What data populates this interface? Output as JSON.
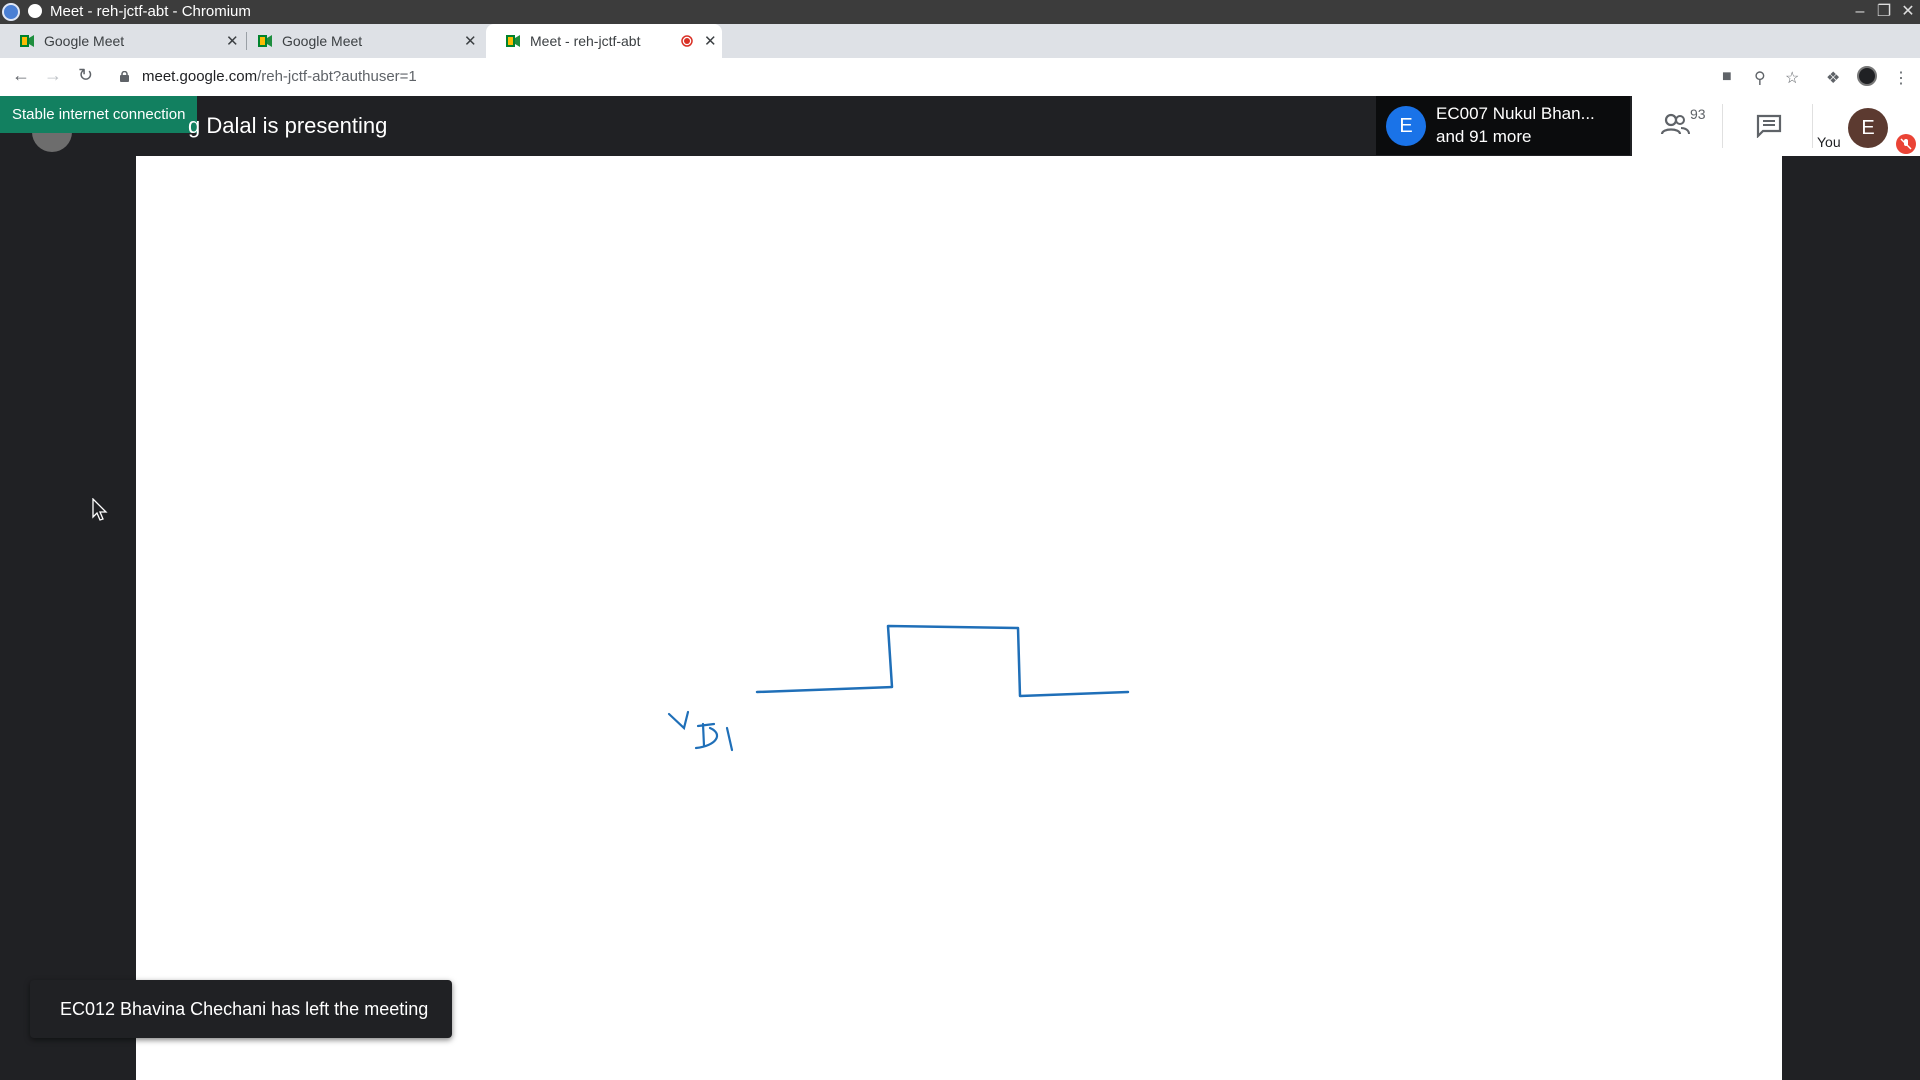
{
  "window": {
    "title": "Meet - reh-jctf-abt - Chromium"
  },
  "tabs": [
    {
      "label": "Google Meet"
    },
    {
      "label": "Google Meet"
    },
    {
      "label": "Meet - reh-jctf-abt"
    }
  ],
  "omnibox": {
    "host": "meet.google.com",
    "path": "/reh-jctf-abt?authuser=1"
  },
  "meet": {
    "connection_status": "Stable internet connection",
    "presenter_text": "g Dalal is presenting",
    "participants_preview": {
      "avatar_letter": "E",
      "line1": "EC007 Nukul Bhan...",
      "line2": "and 91 more"
    },
    "participant_count": "93",
    "self": {
      "label": "You",
      "avatar_letter": "E"
    },
    "toast": "EC012 Bhavina Chechani has left the meeting"
  },
  "colors": {
    "meet_dark": "#202124",
    "stable_green": "#128060",
    "ink_blue": "#1f6fb8",
    "avatar_blue": "#1a73e8",
    "muted_red": "#ea4335"
  },
  "icons": {
    "people": "people-icon",
    "chat": "chat-icon",
    "mic_off": "mic-off-icon"
  }
}
